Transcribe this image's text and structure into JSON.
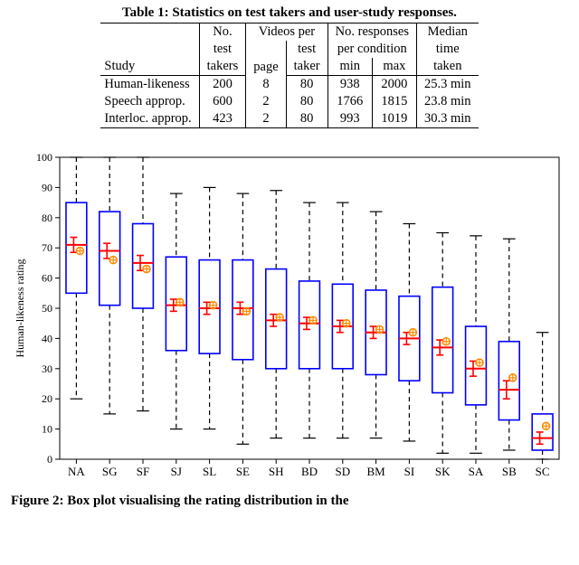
{
  "table": {
    "title": "Table 1: Statistics on test takers and user-study responses.",
    "headers": {
      "study": "Study",
      "no_test_takers_l1": "No.",
      "no_test_takers_l2": "test",
      "no_test_takers_l3": "takers",
      "videos_per": "Videos per",
      "page": "page",
      "test_taker": "test",
      "test_taker_l2": "taker",
      "responses": "No. responses",
      "per_condition": "per condition",
      "min": "min",
      "max": "max",
      "median_l1": "Median",
      "median_l2": "time",
      "median_l3": "taken"
    },
    "rows": [
      {
        "study": "Human-likeness",
        "takers": "200",
        "page": "8",
        "per_taker": "80",
        "min": "938",
        "max": "2000",
        "median": "25.3 min"
      },
      {
        "study": "Speech approp.",
        "takers": "600",
        "page": "2",
        "per_taker": "80",
        "min": "1766",
        "max": "1815",
        "median": "23.8 min"
      },
      {
        "study": "Interloc. approp.",
        "takers": "423",
        "page": "2",
        "per_taker": "80",
        "min": "993",
        "max": "1019",
        "median": "30.3 min"
      }
    ]
  },
  "figure_caption": "Figure 2: Box plot visualising the rating distribution in the",
  "chart_data": {
    "type": "boxplot",
    "title": "",
    "xlabel": "",
    "ylabel": "Human-likeness rating",
    "ylim": [
      0,
      100
    ],
    "yticks": [
      0,
      10,
      20,
      30,
      40,
      50,
      60,
      70,
      80,
      90,
      100
    ],
    "categories": [
      "NA",
      "SG",
      "SF",
      "SJ",
      "SL",
      "SE",
      "SH",
      "BD",
      "SD",
      "BM",
      "SI",
      "SK",
      "SA",
      "SB",
      "SC"
    ],
    "series": [
      {
        "cat": "NA",
        "whisker_low": 20,
        "q1": 55,
        "median": 71,
        "q3": 85,
        "whisker_high": 100,
        "mean": 69,
        "ci": 2.5
      },
      {
        "cat": "SG",
        "whisker_low": 15,
        "q1": 51,
        "median": 69,
        "q3": 82,
        "whisker_high": 100,
        "mean": 66,
        "ci": 2.5
      },
      {
        "cat": "SF",
        "whisker_low": 16,
        "q1": 50,
        "median": 65,
        "q3": 78,
        "whisker_high": 100,
        "mean": 63,
        "ci": 2.5
      },
      {
        "cat": "SJ",
        "whisker_low": 10,
        "q1": 36,
        "median": 51,
        "q3": 67,
        "whisker_high": 88,
        "mean": 52,
        "ci": 2
      },
      {
        "cat": "SL",
        "whisker_low": 10,
        "q1": 35,
        "median": 50,
        "q3": 66,
        "whisker_high": 90,
        "mean": 51,
        "ci": 2
      },
      {
        "cat": "SE",
        "whisker_low": 5,
        "q1": 33,
        "median": 50,
        "q3": 66,
        "whisker_high": 88,
        "mean": 49,
        "ci": 2
      },
      {
        "cat": "SH",
        "whisker_low": 7,
        "q1": 30,
        "median": 46,
        "q3": 63,
        "whisker_high": 89,
        "mean": 47,
        "ci": 2
      },
      {
        "cat": "BD",
        "whisker_low": 7,
        "q1": 30,
        "median": 45,
        "q3": 59,
        "whisker_high": 85,
        "mean": 46,
        "ci": 2
      },
      {
        "cat": "SD",
        "whisker_low": 7,
        "q1": 30,
        "median": 44,
        "q3": 58,
        "whisker_high": 85,
        "mean": 45,
        "ci": 2
      },
      {
        "cat": "BM",
        "whisker_low": 7,
        "q1": 28,
        "median": 42,
        "q3": 56,
        "whisker_high": 82,
        "mean": 43,
        "ci": 2
      },
      {
        "cat": "SI",
        "whisker_low": 6,
        "q1": 26,
        "median": 40,
        "q3": 54,
        "whisker_high": 78,
        "mean": 42,
        "ci": 2
      },
      {
        "cat": "SK",
        "whisker_low": 2,
        "q1": 22,
        "median": 37,
        "q3": 57,
        "whisker_high": 75,
        "mean": 39,
        "ci": 2.5
      },
      {
        "cat": "SA",
        "whisker_low": 2,
        "q1": 18,
        "median": 30,
        "q3": 44,
        "whisker_high": 74,
        "mean": 32,
        "ci": 2.5
      },
      {
        "cat": "SB",
        "whisker_low": 3,
        "q1": 13,
        "median": 23,
        "q3": 39,
        "whisker_high": 73,
        "mean": 27,
        "ci": 3
      },
      {
        "cat": "SC",
        "whisker_low": 0,
        "q1": 3,
        "median": 7,
        "q3": 15,
        "whisker_high": 42,
        "mean": 11,
        "ci": 2
      }
    ]
  }
}
